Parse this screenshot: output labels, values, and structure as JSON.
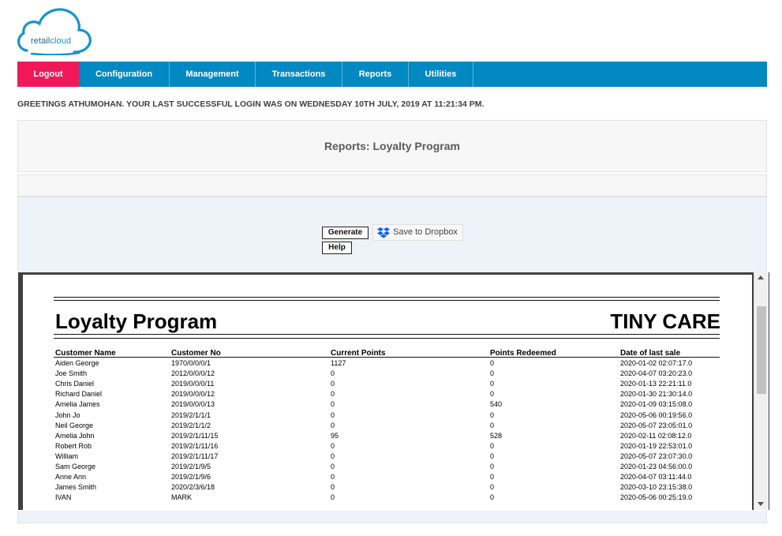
{
  "logo": {
    "part1": "retail",
    "part2": "cloud"
  },
  "nav": [
    {
      "label": "Logout",
      "width": 78
    },
    {
      "label": "Configuration",
      "width": 115
    },
    {
      "label": "Management",
      "width": 109
    },
    {
      "label": "Transactions",
      "width": 110
    },
    {
      "label": "Reports",
      "width": 84
    },
    {
      "label": "Utilities",
      "width": 82
    }
  ],
  "greeting": "GREETINGS ATHUMOHAN. YOUR LAST SUCCESSFUL LOGIN WAS ON WEDNESDAY 10TH JULY, 2019 AT 11:21:34 PM.",
  "page_title": "Reports: Loyalty Program",
  "buttons": {
    "generate": "Generate",
    "help": "Help",
    "dropbox": "Save to Dropbox"
  },
  "report": {
    "title": "Loyalty Program",
    "company": "TINY CARE",
    "columns": [
      "Customer Name",
      "Customer No",
      "Current Points",
      "Points Redeemed",
      "Date of last sale"
    ],
    "rows": [
      [
        "Aiden George",
        "1970/0/0/0/1",
        "1127",
        "0",
        "2020-01-02 02:07:17.0"
      ],
      [
        "Joe Smith",
        "2012/0/0/0/12",
        "0",
        "0",
        "2020-04-07 03:20:23.0"
      ],
      [
        "Chris Daniel",
        "2019/0/0/0/11",
        "0",
        "0",
        "2020-01-13 22:21:11.0"
      ],
      [
        "Richard Daniel",
        "2019/0/0/0/12",
        "0",
        "0",
        "2020-01-30 21:30:14.0"
      ],
      [
        "Amelia James",
        "2019/0/0/0/13",
        "0",
        "540",
        "2020-01-09 03:15:08.0"
      ],
      [
        "John  Jo",
        "2019/2/1/1/1",
        "0",
        "0",
        "2020-05-06 00:19:56.0"
      ],
      [
        "Neil George",
        "2019/2/1/1/2",
        "0",
        "0",
        "2020-05-07 23:05:01.0"
      ],
      [
        "Amelia John",
        "2019/2/1/11/15",
        "95",
        "528",
        "2020-02-11 02:08:12.0"
      ],
      [
        "Robert Rob",
        "2019/2/1/11/16",
        "0",
        "0",
        "2020-01-19 22:53:01.0"
      ],
      [
        "William",
        "2019/2/1/11/17",
        "0",
        "0",
        "2020-05-07 23:07:30.0"
      ],
      [
        "Sam George",
        "2019/2/1/9/5",
        "0",
        "0",
        "2020-01-23 04:56:00.0"
      ],
      [
        "Anne Ann",
        "2019/2/1/9/6",
        "0",
        "0",
        "2020-04-07 03:11:44.0"
      ],
      [
        "James Smith",
        "2020/2/3/6/18",
        "0",
        "0",
        "2020-03-10 23:15:38.0"
      ],
      [
        "IVAN",
        "MARK",
        "0",
        "0",
        "2020-05-06 00:25:19.0"
      ]
    ]
  },
  "colors": {
    "nav_bg": "#0288c2",
    "logout_bg": "#f0185a",
    "logo_blue": "#1693d2"
  },
  "icons": [
    "cloud-logo-icon",
    "dropbox-icon",
    "scroll-up-arrow-icon",
    "scroll-down-arrow-icon"
  ]
}
